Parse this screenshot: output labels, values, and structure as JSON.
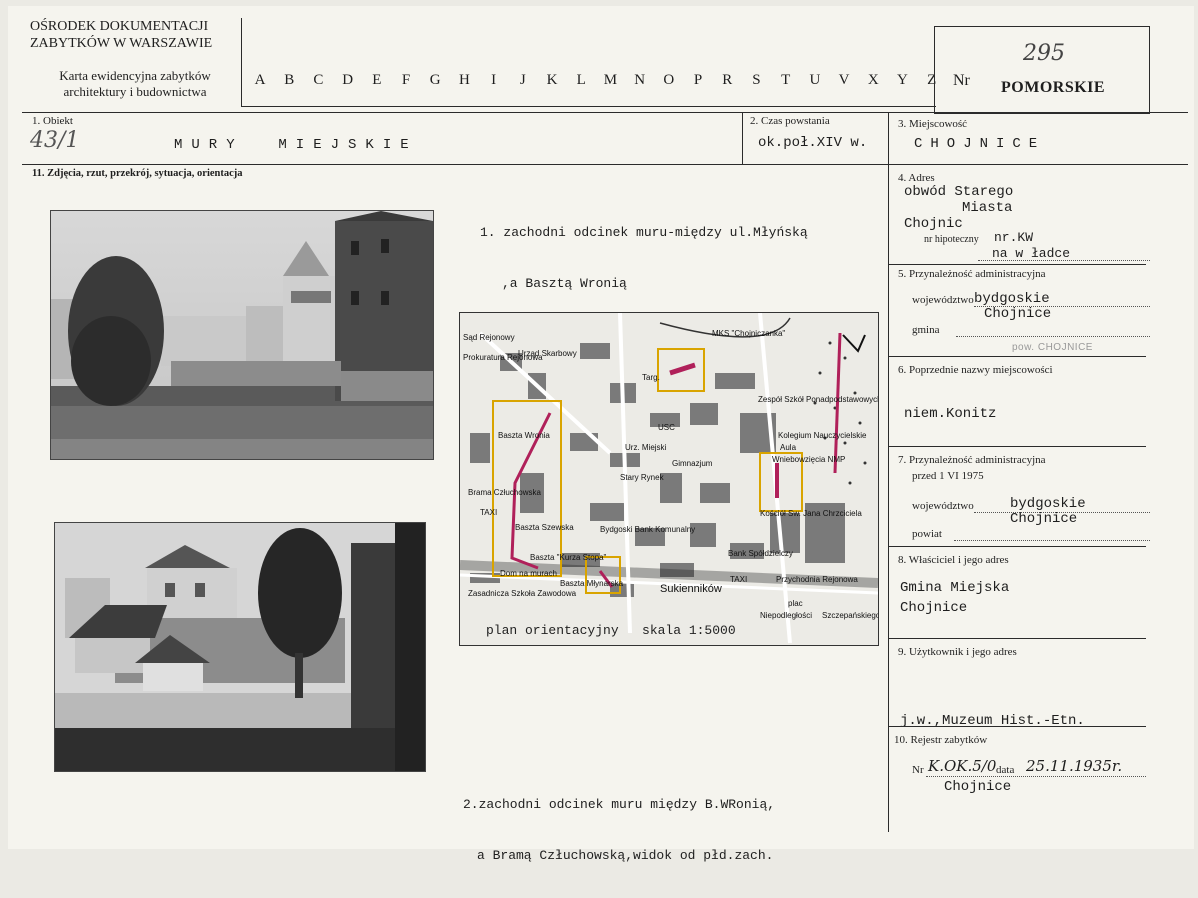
{
  "header": {
    "institution_line1": "OŚRODEK DOKUMENTACJI",
    "institution_line2": "ZABYTKÓW W WARSZAWIE",
    "card_title_line1": "Karta ewidencyjna zabytków",
    "card_title_line2": "architektury i budownictwa",
    "letters": [
      "A",
      "B",
      "C",
      "D",
      "E",
      "F",
      "G",
      "H",
      "I",
      "J",
      "K",
      "L",
      "M",
      "N",
      "O",
      "P",
      "R",
      "S",
      "T",
      "U",
      "V",
      "X",
      "Y",
      "Z"
    ],
    "nr_label": "Nr",
    "nr_value": "295",
    "voivodeship": "POMORSKIE"
  },
  "section1": {
    "label": "1. Obiekt",
    "handwritten": "43/1",
    "value": "MURY  MIEJSKIE"
  },
  "section2": {
    "label": "2. Czas powstania",
    "value": "ok.poł.XIV w."
  },
  "section3": {
    "label": "3. Miejscowość",
    "value": "CHOJNICE"
  },
  "section11": {
    "label": "11. Zdjęcia, rzut, przekrój, sytuacja, orientacja"
  },
  "caption1": {
    "line1": "1. zachodni odcinek muru-między ul.Młyńską",
    "line2": ",a Basztą Wronią"
  },
  "caption2": {
    "line1": "2.zachodni odcinek muru między B.WRonią,",
    "line2": "a Bramą Człuchowską,widok od płd.zach."
  },
  "map": {
    "caption": "plan orientacyjny   skala 1:5000",
    "labels": [
      "Sąd Rejonowy",
      "Prokuratura Rejonowa",
      "Urząd Skarbowy",
      "Targ.",
      "MKS \"Chojniczanka\"",
      "Zespół Szkół Ponadpodstawowych",
      "Kolegium Nauczycielskie",
      "Aula",
      "Urz. Miejski",
      "USC",
      "Gimnazjum",
      "Stary Rynek",
      "Wniebowzięcia NMP",
      "Baszta Wronia",
      "Brama Człuchowska",
      "TAXI",
      "Baszta Szewska",
      "Bydgoski Bank Komunalny",
      "Baszta \"Kurza Stopa\"",
      "Dom na murach",
      "Baszta Młynarska",
      "Sukienników",
      "Bank Spółdzielczy",
      "TAXI",
      "Przychodnia Rejonowa",
      "Zasadnicza Szkoła Zawodowa",
      "Kościół Sw. Jana Chrzciciela",
      "plac",
      "Niepodległości",
      "Szczepańskiego"
    ]
  },
  "section4": {
    "label": "4. Adres",
    "line1": "obwód Starego",
    "line2": "Miasta",
    "line3": "Chojnic",
    "mortgage_label": "nr hipoteczny",
    "mortgage_value": "nr.KW",
    "mortgage_value2": "na w ładce"
  },
  "section5": {
    "label": "5. Przynależność administracyjna",
    "woj_label": "województwo",
    "woj_value": "bydgoskie",
    "woj_value2": "Chojnice",
    "gmina_label": "gmina",
    "stamp": "pow. CHOJNICE"
  },
  "section6": {
    "label": "6. Poprzednie nazwy miejscowości",
    "value": "niem.Konitz"
  },
  "section7": {
    "label": "7. Przynależność administracyjna",
    "sub": "przed 1 VI 1975",
    "woj_label": "województwo",
    "woj_value": "bydgoskie",
    "powiat_label": "powiat",
    "powiat_value": "Chojnice"
  },
  "section8": {
    "label": "8. Właściciel i jego adres",
    "line1": "Gmina Miejska",
    "line2": "Chojnice"
  },
  "section9": {
    "label": "9. Użytkownik i jego adres",
    "line1": "j.w.,Muzeum Hist.-Etn.",
    "line2": "Chojnice"
  },
  "section10": {
    "label": "10. Rejestr zabytków",
    "nr_label": "Nr",
    "nr_value": "K.OK.5/0",
    "data_label": "data",
    "data_value": "25.11.1935r."
  },
  "colors": {
    "paper": "#f5f4ee",
    "ink": "#1e1e1e",
    "map_marker_yellow": "#d9a400",
    "map_marker_magenta": "#b0205a"
  }
}
